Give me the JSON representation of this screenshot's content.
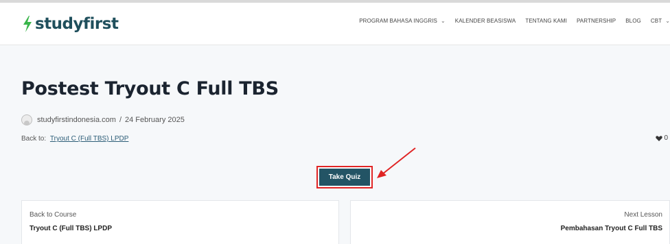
{
  "header": {
    "logo_text": "studyfirst",
    "brand_color": "#1f4f5c",
    "accent_color": "#39b54a",
    "nav": [
      {
        "label": "PROGRAM BAHASA INGGRIS",
        "has_dropdown": true
      },
      {
        "label": "KALENDER BEASISWA",
        "has_dropdown": false
      },
      {
        "label": "TENTANG KAMI",
        "has_dropdown": false
      },
      {
        "label": "PARTNERSHIP",
        "has_dropdown": false
      },
      {
        "label": "BLOG",
        "has_dropdown": false
      },
      {
        "label": "CBT",
        "has_dropdown": true
      }
    ],
    "chevron_glyph": "⌄"
  },
  "page": {
    "title": "Postest Tryout C Full TBS",
    "author": "studyfirstindonesia.com",
    "meta_separator": "/",
    "date": "24 February 2025",
    "back_to_label": "Back to:",
    "back_to_link": "Tryout C (Full TBS) LPDP",
    "likes_count": "0"
  },
  "quiz": {
    "button_label": "Take Quiz",
    "button_color": "#235465",
    "highlight_color": "#e02424"
  },
  "lesson_nav": {
    "prev_label": "Back to Course",
    "prev_title": "Tryout C (Full TBS) LPDP",
    "next_label": "Next Lesson",
    "next_title": "Pembahasan Tryout C Full TBS"
  }
}
